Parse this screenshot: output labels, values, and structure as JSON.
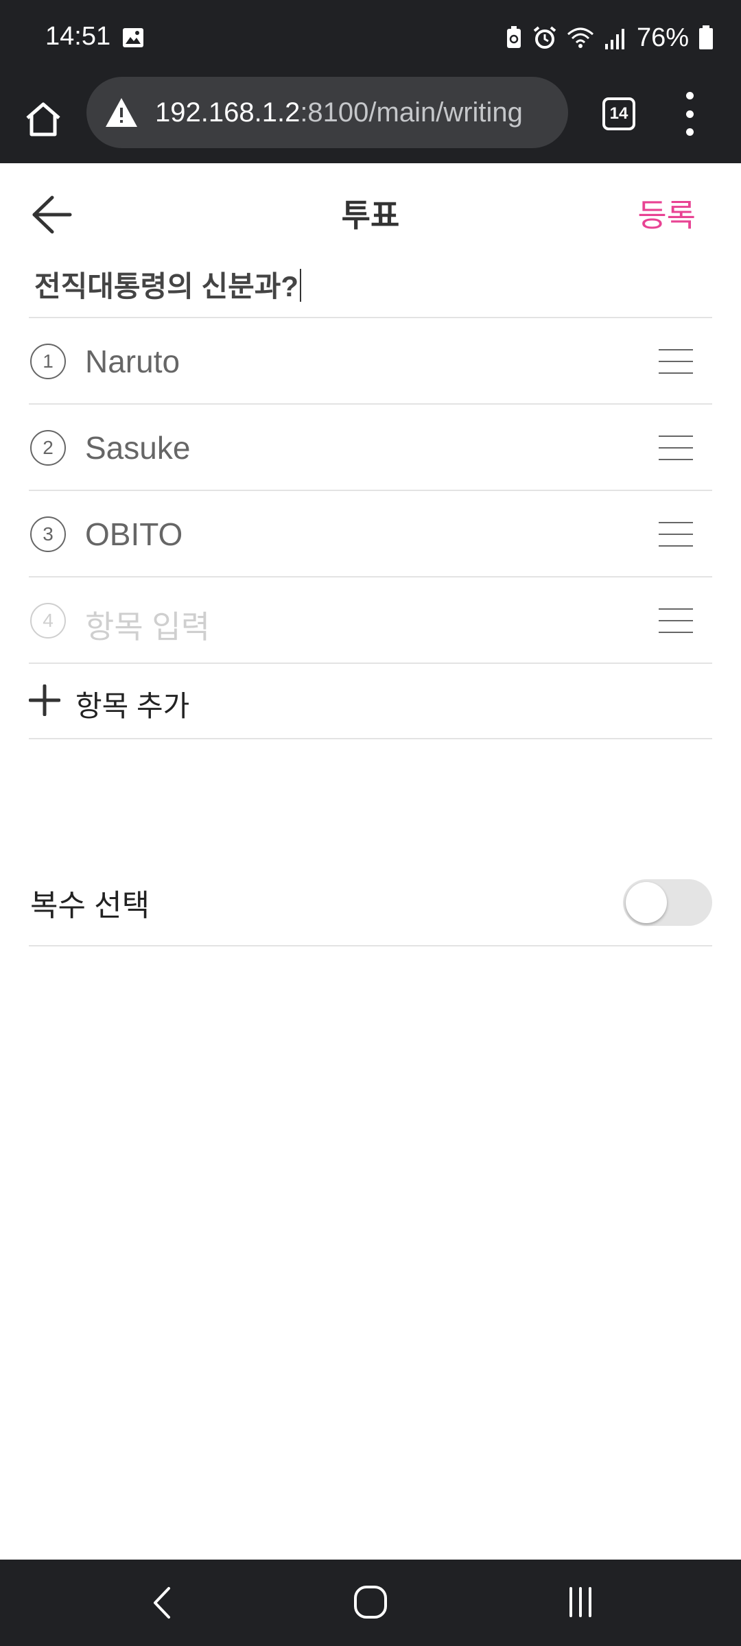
{
  "status": {
    "time": "14:51",
    "battery_pct": "76%",
    "icons": [
      "image-icon",
      "battery-saver-icon",
      "alarm-icon",
      "wifi-icon",
      "signal-icon",
      "battery-icon"
    ]
  },
  "browser": {
    "url_host": "192.168.1.2",
    "url_path": ":8100/main/writing",
    "tab_count": "14"
  },
  "header": {
    "title": "투표",
    "register_label": "등록"
  },
  "poll": {
    "question": "전직대통령의 신분과?",
    "options": [
      {
        "num": "1",
        "label": "Naruto"
      },
      {
        "num": "2",
        "label": "Sasuke"
      },
      {
        "num": "3",
        "label": "OBITO"
      }
    ],
    "new_option": {
      "num": "4",
      "placeholder": "항목 입력"
    },
    "add_option_label": "항목 추가",
    "multi_select_label": "복수 선택",
    "multi_select_enabled": false
  },
  "colors": {
    "accent": "#e84393",
    "system_bar": "#202124"
  }
}
